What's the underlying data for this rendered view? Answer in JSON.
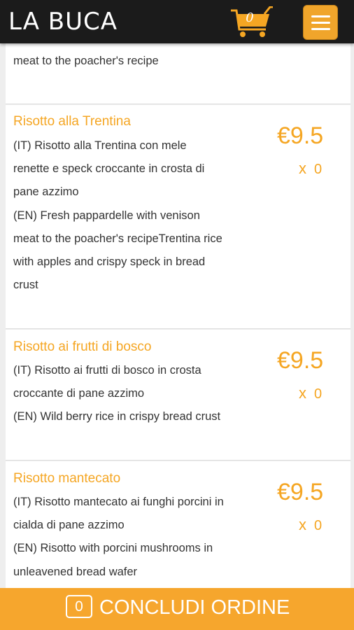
{
  "header": {
    "logo": "LA BUCA",
    "cart_count": "0",
    "cart_icon": "shopping-cart-icon",
    "menu_icon": "hamburger-menu-icon"
  },
  "items": [
    {
      "title": "",
      "desc": "meat to the poacher's recipe",
      "price": "",
      "qty": ""
    },
    {
      "title": "Risotto alla Trentina",
      "desc": "(IT) Risotto alla Trentina con mele\nrenette e speck croccante in crosta di\npane azzimo\n(EN) Fresh pappardelle with venison\nmeat to the poacher's recipeTrentina rice\nwith apples and crispy speck in bread\ncrust",
      "price": "€9.5",
      "qty": "0"
    },
    {
      "title": "Risotto ai frutti di bosco",
      "desc": "(IT) Risotto ai frutti di bosco in crosta\ncroccante di pane azzimo\n(EN) Wild berry rice in crispy bread crust",
      "price": "€9.5",
      "qty": "0"
    },
    {
      "title": "Risotto mantecato",
      "desc": "(IT) Risotto mantecato ai funghi porcini in\ncialda di pane azzimo\n(EN) Risotto with porcini mushrooms in\nunleavened bread wafer",
      "price": "€9.5",
      "qty": "0"
    }
  ],
  "qty_prefix": "x",
  "footer": {
    "count": "0",
    "label": "CONCLUDI ORDINE"
  },
  "colors": {
    "accent": "#f5a623",
    "header_bg": "#1b1b1b",
    "footer_bg": "#f6a62d"
  }
}
